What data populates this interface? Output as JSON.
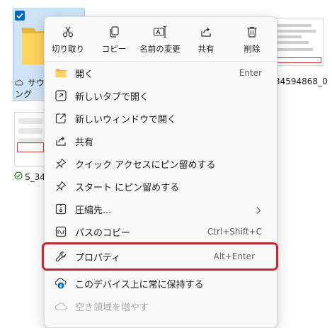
{
  "background": {
    "selected_tile": {
      "name": "サウンドング",
      "line1": "サウン",
      "line2": "ング"
    },
    "right_file_label": "_34594868_0",
    "left_file_label": "S_34"
  },
  "toolbar": {
    "cut_label": "切り取り",
    "copy_label": "コピー",
    "rename_label": "名前の変更",
    "share_label": "共有",
    "delete_label": "削除"
  },
  "menu": {
    "items": [
      {
        "label": "開く",
        "shortcut": "Enter"
      },
      {
        "label": "新しいタブで開く",
        "shortcut": ""
      },
      {
        "label": "新しいウィンドウで開く",
        "shortcut": ""
      },
      {
        "label": "共有",
        "shortcut": ""
      },
      {
        "label": "クイック アクセスにピン留めする",
        "shortcut": ""
      },
      {
        "label": "スタート にピン留めする",
        "shortcut": ""
      },
      {
        "label": "圧縮先...",
        "shortcut": ""
      },
      {
        "label": "パスのコピー",
        "shortcut": "Ctrl+Shift+C"
      },
      {
        "label": "プロパティ",
        "shortcut": "Alt+Enter"
      },
      {
        "label": "このデバイス上に常に保持する",
        "shortcut": ""
      },
      {
        "label": "空き領域を増やす",
        "shortcut": ""
      }
    ]
  },
  "colors": {
    "accent": "#0067c0",
    "highlight_border": "#c4272f",
    "selection_bg": "#cfe4f7",
    "menu_bg": "#f9f9f9"
  },
  "icons": {
    "cut": "scissors-icon",
    "copy": "copy-icon",
    "rename": "rename-icon",
    "share": "share-icon",
    "delete": "trash-icon"
  }
}
